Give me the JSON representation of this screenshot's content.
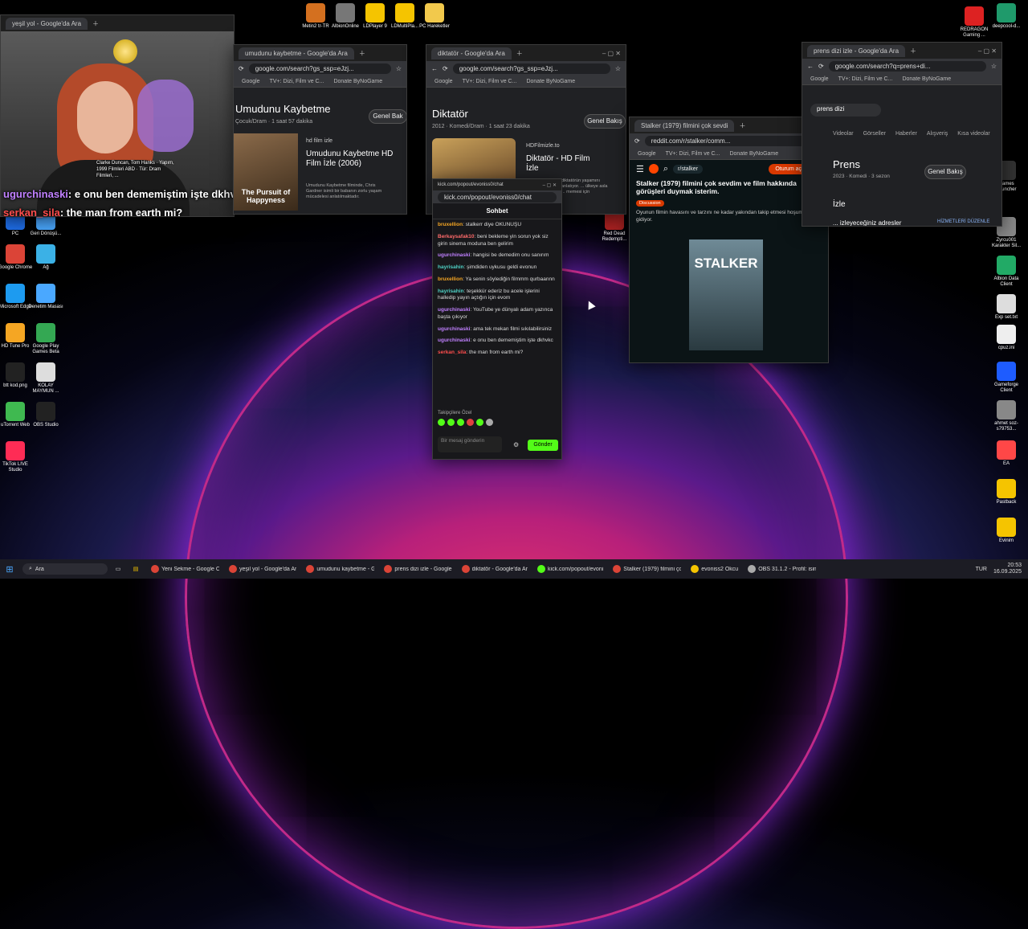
{
  "desktop": {
    "top_icons": [
      {
        "label": "Metin2 tr-TR",
        "color": "#d4701f"
      },
      {
        "label": "AlbionOnline",
        "color": "#777"
      },
      {
        "label": "LDPlayer 9",
        "color": "#f5c400"
      },
      {
        "label": "LDMultiPla...",
        "color": "#f5c400"
      },
      {
        "label": "PC Hareketler",
        "color": "#f2c94c"
      }
    ],
    "left_icons": [
      "PC",
      "Geri Dönüşü...",
      "Google Chrome",
      "Ağ",
      "Microsoft Edge",
      "Denetim Masası",
      "HD Tune Pro",
      "Google Play Games Beta",
      "btt kod.png",
      "KOLAY MAYMUN ...",
      "uTorrent Web",
      "OBS Studio",
      "TikTok LIVE Studio"
    ],
    "right_icons": [
      "REDRAGON Gaming ...",
      "deepcool-d...",
      "Games Launcher",
      "Zyrcu001 Karakter Sil...",
      "Albion Data Client",
      "Exp set.txt",
      "cpuz.ini",
      "Gameforge Client",
      "ahmet soz-s79753...",
      "EA",
      "Pastback",
      "Evinim",
      "Red Dead Redempti..."
    ]
  },
  "webcam": {
    "title": "yeşil yol - Google'da Ara",
    "line1_user": "ugurchinaski",
    "line1_text": ": e onu ben dememiştim işte dkhvkc",
    "line2_user": "serkan_sila",
    "line2_text": ": the man from earth mi?"
  },
  "win_umudunu": {
    "tab": "umudunu kaybetme - Google'da Ara",
    "url": "google.com/search?gs_ssp=eJzj...",
    "bookmarks": [
      "Google",
      "TV+: Dizi, Film ve C...",
      "Donate ByNoGame"
    ],
    "heading": "Umudunu Kaybetme",
    "sub": "Çocuk/Dram · 1 saat 57 dakika",
    "genel": "Genel Bak",
    "card_source": "hd film izle",
    "card_title": "Umudunu Kaybetme HD Film İzle (2006)",
    "cast": "Clarke Duncan, Tom Hanks · Yapım, 1999 Filmleri ABD · Tür: Dram Filmleri, ...",
    "poster_text": "The Pursuit of Happyness",
    "snippet": "Umudunu Kaybetme filminde, Chris Gardner isimli bir babanın zorlu yaşam mücadelesi anlatılmaktadır."
  },
  "win_diktator": {
    "tab": "diktatör - Google'da Ara",
    "url": "google.com/search?gs_ssp=eJzj...",
    "heading": "Diktatör",
    "sub": "2012 · Komedi/Dram · 1 saat 23 dakika",
    "genel": "Genel Bakış",
    "card_source": "HDFilmizle.to",
    "card_title": "Diktatör - HD Film İzle",
    "snippet": "diktatörün yaşamını anlatıyor. ... ülkeye asla ... memesi için"
  },
  "chat": {
    "url": "kick.com/popout/evoniss0/chat",
    "title": "Sohbet",
    "messages": [
      {
        "user": "bruxellion",
        "color": "#f5a623",
        "text": ": stalkerr diye OKUNUŞU"
      },
      {
        "user": "Berkaysafak10",
        "color": "#ff6b6b",
        "text": ": beni bekleme yin sorun yok siz girin sinema moduna ben gelirim"
      },
      {
        "user": "ugurchinaski",
        "color": "#c080ff",
        "text": ": hangisi be demedim onu sanırım"
      },
      {
        "user": "hayrisahin",
        "color": "#4fd1c5",
        "text": ": şimdiden uykusu geldi evonun"
      },
      {
        "user": "bruxellion",
        "color": "#f5a623",
        "text": ": Ya senin söylediğin filmmm qurbaannn"
      },
      {
        "user": "hayrisahin",
        "color": "#4fd1c5",
        "text": ": teşekkür ederiz bu acele işlerini halledip yayın açtığın için evom"
      },
      {
        "user": "ugurchinaski",
        "color": "#c080ff",
        "text": ": YouTube ye dünyalı adam yazınca başta çıkıyor"
      },
      {
        "user": "ugurchinaski",
        "color": "#c080ff",
        "text": ": ama tek mekan filmi sıkılabilirsiniz"
      },
      {
        "user": "ugurchinaski",
        "color": "#c080ff",
        "text": ": e onu ben dememiştim işte dkhvkc"
      },
      {
        "user": "serkan_sila",
        "color": "#ff4d4d",
        "text": ": the man from earth mi?"
      }
    ],
    "follow_label": "Takipçilere Özel",
    "input_placeholder": "Bir mesaj gönderin",
    "send": "Gönder"
  },
  "win_reddit": {
    "tab": "Stalker (1979) filmini çok sevdi",
    "url": "reddit.com/r/stalker/comm...",
    "bookmarks": [
      "Google",
      "TV+: Dizi, Film ve C...",
      "Donate ByNoGame"
    ],
    "subreddit": "r/stalker",
    "login": "Oturum aç",
    "post_title": "Stalker (1979) filmini çok sevdim ve film hakkında görüşleri duymak isterim.",
    "flair": "Discussion",
    "body": "Oyunun filmin havasını ve tarzını ne kadar yakından takip etmesi hoşuma gidiyor.",
    "poster": "STALKER"
  },
  "win_prens": {
    "tab": "prens dizi izle - Google'da Ara",
    "url": "google.com/search?q=prens+di...",
    "bookmarks": [
      "Google",
      "TV+: Dizi, Film ve C...",
      "Donate ByNoGame"
    ],
    "search": "prens dizi",
    "tabs": [
      "Videolar",
      "Görseller",
      "Haberler",
      "Alışveriş",
      "Kısa videolar"
    ],
    "heading": "Prens",
    "sub": "2023 · Komedi · 3 sezon",
    "genel": "Genel Bakış",
    "izle": "İzle",
    "adresler": "... izleyeceğiniz adresler",
    "hizmet": "HİZMETLERİ DÜZENLE"
  },
  "taskbar": {
    "search": "Ara",
    "items": [
      "Yeni Sekme - Google Ch",
      "yeşil yol - Google'da Ar",
      "umudunu kaybetme - G",
      "prens dizi izle - Google",
      "diktatör - Google'da Ar",
      "kick.com/popout/evoni",
      "Stalker (1979) filmini çok",
      "evoniss2 Okcu",
      "OBS 31.1.2 - Profil: isimsi"
    ],
    "lang": "TUR",
    "time": "20:53",
    "date": "16.09.2025"
  }
}
